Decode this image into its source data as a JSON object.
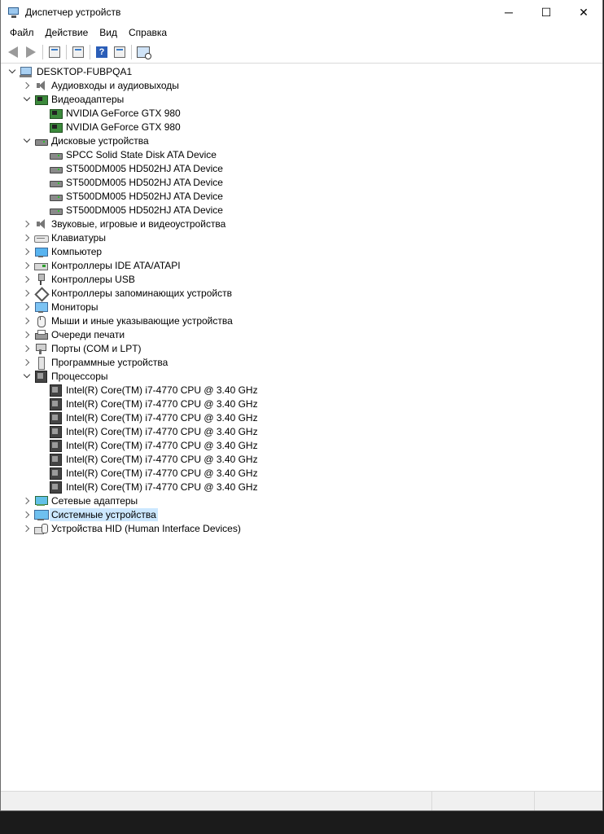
{
  "window": {
    "title": "Диспетчер устройств",
    "controls": {
      "minimize": "─",
      "maximize": "☐",
      "close": "✕"
    }
  },
  "menu": [
    "Файл",
    "Действие",
    "Вид",
    "Справка"
  ],
  "toolbar": {
    "buttons": [
      "back-icon",
      "forward-icon",
      "properties-icon",
      "show-hide-icon",
      "help-icon",
      "view-icon",
      "scan-hardware-icon"
    ]
  },
  "tree": [
    {
      "level": 0,
      "state": "expanded",
      "icon": "computer",
      "label": "DESKTOP-FUBPQA1"
    },
    {
      "level": 1,
      "state": "collapsed",
      "icon": "audio",
      "label": "Аудиовходы и аудиовыходы"
    },
    {
      "level": 1,
      "state": "expanded",
      "icon": "gpu",
      "label": "Видеоадаптеры"
    },
    {
      "level": 2,
      "state": "none",
      "icon": "gpu",
      "label": "NVIDIA GeForce GTX 980"
    },
    {
      "level": 2,
      "state": "none",
      "icon": "gpu",
      "label": "NVIDIA GeForce GTX 980"
    },
    {
      "level": 1,
      "state": "expanded",
      "icon": "disk",
      "label": "Дисковые устройства"
    },
    {
      "level": 2,
      "state": "none",
      "icon": "disk",
      "label": "SPCC Solid State Disk ATA Device"
    },
    {
      "level": 2,
      "state": "none",
      "icon": "disk",
      "label": "ST500DM005 HD502HJ ATA Device"
    },
    {
      "level": 2,
      "state": "none",
      "icon": "disk",
      "label": "ST500DM005 HD502HJ ATA Device"
    },
    {
      "level": 2,
      "state": "none",
      "icon": "disk",
      "label": "ST500DM005 HD502HJ ATA Device"
    },
    {
      "level": 2,
      "state": "none",
      "icon": "disk",
      "label": "ST500DM005 HD502HJ ATA Device"
    },
    {
      "level": 1,
      "state": "collapsed",
      "icon": "audio",
      "label": "Звуковые, игровые и видеоустройства"
    },
    {
      "level": 1,
      "state": "collapsed",
      "icon": "keyboard",
      "label": "Клавиатуры"
    },
    {
      "level": 1,
      "state": "collapsed",
      "icon": "desktop",
      "label": "Компьютер"
    },
    {
      "level": 1,
      "state": "collapsed",
      "icon": "ide",
      "label": "Контроллеры IDE ATA/ATAPI"
    },
    {
      "level": 1,
      "state": "collapsed",
      "icon": "usb",
      "label": "Контроллеры USB"
    },
    {
      "level": 1,
      "state": "collapsed",
      "icon": "storage",
      "label": "Контроллеры запоминающих устройств"
    },
    {
      "level": 1,
      "state": "collapsed",
      "icon": "monitor",
      "label": "Мониторы"
    },
    {
      "level": 1,
      "state": "collapsed",
      "icon": "mouse",
      "label": "Мыши и иные указывающие устройства"
    },
    {
      "level": 1,
      "state": "collapsed",
      "icon": "printer",
      "label": "Очереди печати"
    },
    {
      "level": 1,
      "state": "collapsed",
      "icon": "port",
      "label": "Порты (COM и LPT)"
    },
    {
      "level": 1,
      "state": "collapsed",
      "icon": "software",
      "label": "Программные устройства"
    },
    {
      "level": 1,
      "state": "expanded",
      "icon": "cpu",
      "label": "Процессоры"
    },
    {
      "level": 2,
      "state": "none",
      "icon": "cpu",
      "label": "Intel(R) Core(TM) i7-4770 CPU @ 3.40 GHz"
    },
    {
      "level": 2,
      "state": "none",
      "icon": "cpu",
      "label": "Intel(R) Core(TM) i7-4770 CPU @ 3.40 GHz"
    },
    {
      "level": 2,
      "state": "none",
      "icon": "cpu",
      "label": "Intel(R) Core(TM) i7-4770 CPU @ 3.40 GHz"
    },
    {
      "level": 2,
      "state": "none",
      "icon": "cpu",
      "label": "Intel(R) Core(TM) i7-4770 CPU @ 3.40 GHz"
    },
    {
      "level": 2,
      "state": "none",
      "icon": "cpu",
      "label": "Intel(R) Core(TM) i7-4770 CPU @ 3.40 GHz"
    },
    {
      "level": 2,
      "state": "none",
      "icon": "cpu",
      "label": "Intel(R) Core(TM) i7-4770 CPU @ 3.40 GHz"
    },
    {
      "level": 2,
      "state": "none",
      "icon": "cpu",
      "label": "Intel(R) Core(TM) i7-4770 CPU @ 3.40 GHz"
    },
    {
      "level": 2,
      "state": "none",
      "icon": "cpu",
      "label": "Intel(R) Core(TM) i7-4770 CPU @ 3.40 GHz"
    },
    {
      "level": 1,
      "state": "collapsed",
      "icon": "network",
      "label": "Сетевые адаптеры"
    },
    {
      "level": 1,
      "state": "collapsed",
      "icon": "system",
      "label": "Системные устройства",
      "selected": true
    },
    {
      "level": 1,
      "state": "collapsed",
      "icon": "hid",
      "label": "Устройства HID (Human Interface Devices)"
    }
  ],
  "colors": {
    "selection": "#cce8ff",
    "taskbar": "#1b1b1b"
  }
}
